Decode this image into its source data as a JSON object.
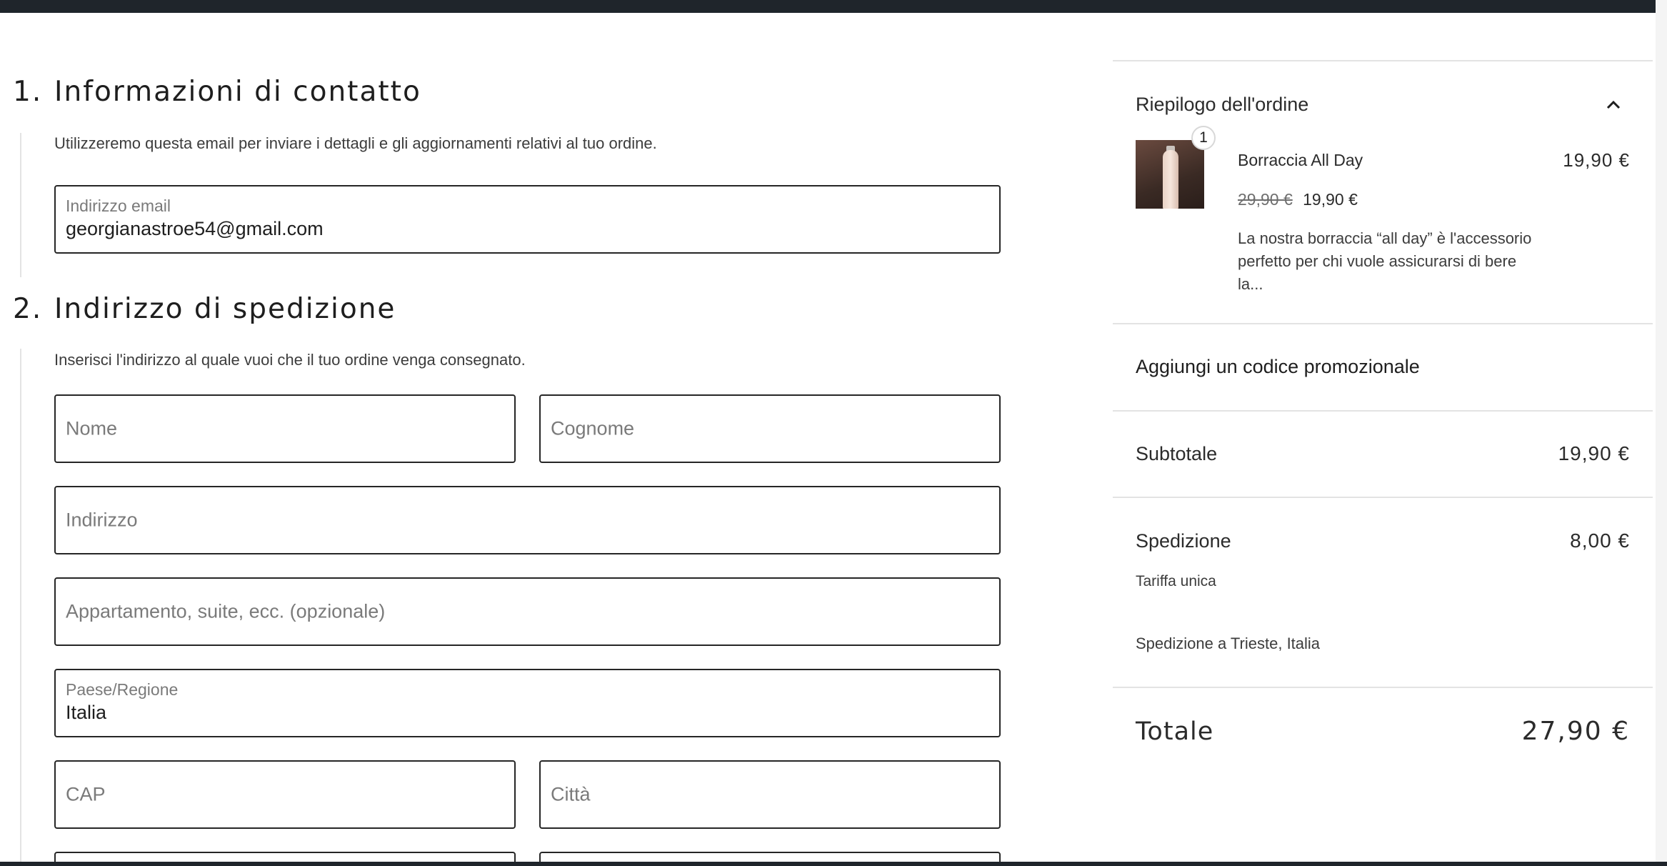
{
  "contact": {
    "step_number": "1.",
    "title": "Informazioni di contatto",
    "description": "Utilizzeremo questa email per inviare i dettagli e gli aggiornamenti relativi al tuo ordine.",
    "email_label": "Indirizzo email",
    "email_value": "georgianastroe54@gmail.com"
  },
  "shipping": {
    "step_number": "2.",
    "title": "Indirizzo di spedizione",
    "description": "Inserisci l'indirizzo al quale vuoi che il tuo ordine venga consegnato.",
    "first_name_placeholder": "Nome",
    "last_name_placeholder": "Cognome",
    "address_placeholder": "Indirizzo",
    "apartment_placeholder": "Appartamento, suite, ecc. (opzionale)",
    "country_label": "Paese/Regione",
    "country_value": "Italia",
    "zip_placeholder": "CAP",
    "city_placeholder": "Città"
  },
  "summary": {
    "title": "Riepilogo dell'ordine",
    "item": {
      "quantity": "1",
      "name": "Borraccia All Day",
      "price": "19,90 €",
      "original_price": "29,90 €",
      "sale_price": "19,90 €",
      "description_line1": "La nostra borraccia “all day” è l'accessorio",
      "description_line2": "perfetto per chi vuole assicurarsi di bere",
      "description_line3": "la..."
    },
    "promo_label": "Aggiungi un codice promozionale",
    "subtotal_label": "Subtotale",
    "subtotal_value": "19,90 €",
    "shipping_label": "Spedizione",
    "shipping_value": "8,00 €",
    "shipping_method": "Tariffa unica",
    "shipping_destination": "Spedizione a Trieste, Italia",
    "total_label": "Totale",
    "total_value": "27,90 €"
  }
}
